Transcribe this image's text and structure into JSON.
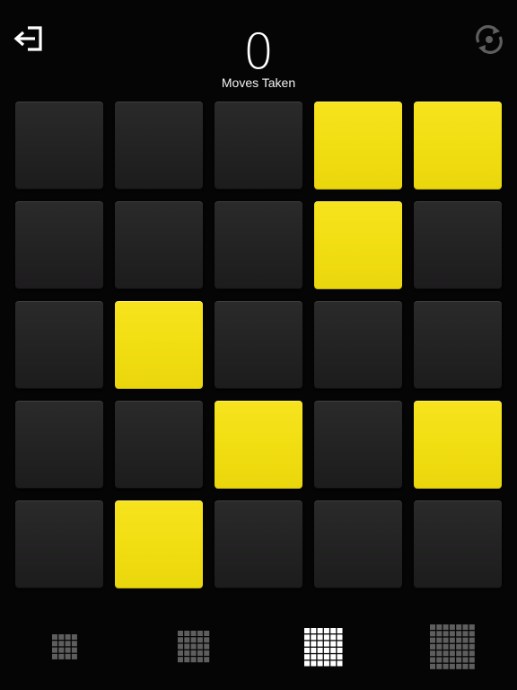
{
  "header": {
    "move_count": "0",
    "move_label": "Moves Taken",
    "exit_icon": "exit-icon",
    "restart_icon": "restart-icon"
  },
  "board": {
    "rows": 5,
    "cols": 5,
    "cells": [
      [
        0,
        0,
        0,
        1,
        1
      ],
      [
        0,
        0,
        0,
        1,
        0
      ],
      [
        0,
        1,
        0,
        0,
        0
      ],
      [
        0,
        0,
        1,
        0,
        1
      ],
      [
        0,
        1,
        0,
        0,
        0
      ]
    ]
  },
  "grid_sizes": [
    {
      "size": 4,
      "selected": false
    },
    {
      "size": 5,
      "selected": false
    },
    {
      "size": 6,
      "selected": true
    },
    {
      "size": 7,
      "selected": false
    }
  ],
  "colors": {
    "background": "#050505",
    "tile_on": "#f1de12",
    "tile_off": "#242324",
    "icon_light": "#ffffff",
    "icon_dim": "#5e5e5e"
  }
}
